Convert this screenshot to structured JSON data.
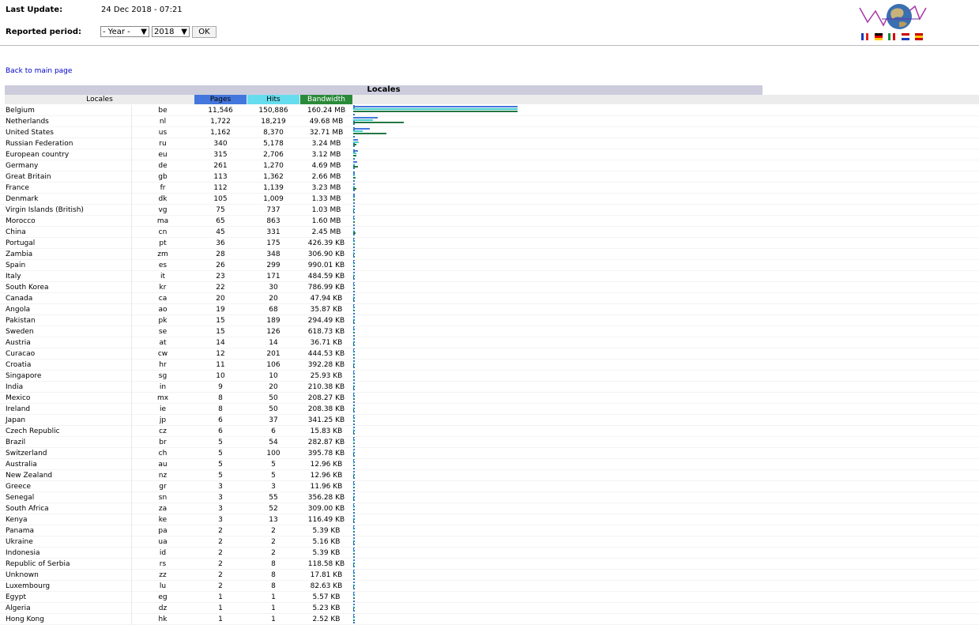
{
  "header": {
    "last_update_label": "Last Update:",
    "last_update_value": "24 Dec 2018 - 07:21",
    "reported_period_label": "Reported period:",
    "period_select": "- Year -",
    "year_select": "2018",
    "ok_label": "OK"
  },
  "flags": [
    "flag-fr",
    "flag-de",
    "flag-it",
    "flag-nl",
    "flag-es"
  ],
  "back_link": "Back to main page",
  "table": {
    "title": "Locales",
    "columns": {
      "locales": "Locales",
      "pages": "Pages",
      "hits": "Hits",
      "bandwidth": "Bandwidth"
    },
    "colors": {
      "pages": "#4477dd",
      "hits": "#66ddee",
      "bandwidth": "#2a8a3a"
    },
    "rows": [
      {
        "name": "Belgium",
        "code": "be",
        "pages": "11,546",
        "hits": "150,886",
        "bw": "160.24 MB",
        "p": 11546,
        "h": 150886,
        "b": 160.24
      },
      {
        "name": "Netherlands",
        "code": "nl",
        "pages": "1,722",
        "hits": "18,219",
        "bw": "49.68 MB",
        "p": 1722,
        "h": 18219,
        "b": 49.68
      },
      {
        "name": "United States",
        "code": "us",
        "pages": "1,162",
        "hits": "8,370",
        "bw": "32.71 MB",
        "p": 1162,
        "h": 8370,
        "b": 32.71
      },
      {
        "name": "Russian Federation",
        "code": "ru",
        "pages": "340",
        "hits": "5,178",
        "bw": "3.24 MB",
        "p": 340,
        "h": 5178,
        "b": 3.24
      },
      {
        "name": "European country",
        "code": "eu",
        "pages": "315",
        "hits": "2,706",
        "bw": "3.12 MB",
        "p": 315,
        "h": 2706,
        "b": 3.12
      },
      {
        "name": "Germany",
        "code": "de",
        "pages": "261",
        "hits": "1,270",
        "bw": "4.69 MB",
        "p": 261,
        "h": 1270,
        "b": 4.69
      },
      {
        "name": "Great Britain",
        "code": "gb",
        "pages": "113",
        "hits": "1,362",
        "bw": "2.66 MB",
        "p": 113,
        "h": 1362,
        "b": 2.66
      },
      {
        "name": "France",
        "code": "fr",
        "pages": "112",
        "hits": "1,139",
        "bw": "3.23 MB",
        "p": 112,
        "h": 1139,
        "b": 3.23
      },
      {
        "name": "Denmark",
        "code": "dk",
        "pages": "105",
        "hits": "1,009",
        "bw": "1.33 MB",
        "p": 105,
        "h": 1009,
        "b": 1.33
      },
      {
        "name": "Virgin Islands (British)",
        "code": "vg",
        "pages": "75",
        "hits": "737",
        "bw": "1.03 MB",
        "p": 75,
        "h": 737,
        "b": 1.03
      },
      {
        "name": "Morocco",
        "code": "ma",
        "pages": "65",
        "hits": "863",
        "bw": "1.60 MB",
        "p": 65,
        "h": 863,
        "b": 1.6
      },
      {
        "name": "China",
        "code": "cn",
        "pages": "45",
        "hits": "331",
        "bw": "2.45 MB",
        "p": 45,
        "h": 331,
        "b": 2.45
      },
      {
        "name": "Portugal",
        "code": "pt",
        "pages": "36",
        "hits": "175",
        "bw": "426.39 KB",
        "p": 36,
        "h": 175,
        "b": 0.416
      },
      {
        "name": "Zambia",
        "code": "zm",
        "pages": "28",
        "hits": "348",
        "bw": "306.90 KB",
        "p": 28,
        "h": 348,
        "b": 0.3
      },
      {
        "name": "Spain",
        "code": "es",
        "pages": "26",
        "hits": "299",
        "bw": "990.01 KB",
        "p": 26,
        "h": 299,
        "b": 0.967
      },
      {
        "name": "Italy",
        "code": "it",
        "pages": "23",
        "hits": "171",
        "bw": "484.59 KB",
        "p": 23,
        "h": 171,
        "b": 0.473
      },
      {
        "name": "South Korea",
        "code": "kr",
        "pages": "22",
        "hits": "30",
        "bw": "786.99 KB",
        "p": 22,
        "h": 30,
        "b": 0.769
      },
      {
        "name": "Canada",
        "code": "ca",
        "pages": "20",
        "hits": "20",
        "bw": "47.94 KB",
        "p": 20,
        "h": 20,
        "b": 0.047
      },
      {
        "name": "Angola",
        "code": "ao",
        "pages": "19",
        "hits": "68",
        "bw": "35.87 KB",
        "p": 19,
        "h": 68,
        "b": 0.035
      },
      {
        "name": "Pakistan",
        "code": "pk",
        "pages": "15",
        "hits": "189",
        "bw": "294.49 KB",
        "p": 15,
        "h": 189,
        "b": 0.288
      },
      {
        "name": "Sweden",
        "code": "se",
        "pages": "15",
        "hits": "126",
        "bw": "618.73 KB",
        "p": 15,
        "h": 126,
        "b": 0.604
      },
      {
        "name": "Austria",
        "code": "at",
        "pages": "14",
        "hits": "14",
        "bw": "36.71 KB",
        "p": 14,
        "h": 14,
        "b": 0.036
      },
      {
        "name": "Curacao",
        "code": "cw",
        "pages": "12",
        "hits": "201",
        "bw": "444.53 KB",
        "p": 12,
        "h": 201,
        "b": 0.434
      },
      {
        "name": "Croatia",
        "code": "hr",
        "pages": "11",
        "hits": "106",
        "bw": "392.28 KB",
        "p": 11,
        "h": 106,
        "b": 0.383
      },
      {
        "name": "Singapore",
        "code": "sg",
        "pages": "10",
        "hits": "10",
        "bw": "25.93 KB",
        "p": 10,
        "h": 10,
        "b": 0.025
      },
      {
        "name": "India",
        "code": "in",
        "pages": "9",
        "hits": "20",
        "bw": "210.38 KB",
        "p": 9,
        "h": 20,
        "b": 0.205
      },
      {
        "name": "Mexico",
        "code": "mx",
        "pages": "8",
        "hits": "50",
        "bw": "208.27 KB",
        "p": 8,
        "h": 50,
        "b": 0.203
      },
      {
        "name": "Ireland",
        "code": "ie",
        "pages": "8",
        "hits": "50",
        "bw": "208.38 KB",
        "p": 8,
        "h": 50,
        "b": 0.203
      },
      {
        "name": "Japan",
        "code": "jp",
        "pages": "6",
        "hits": "37",
        "bw": "341.25 KB",
        "p": 6,
        "h": 37,
        "b": 0.333
      },
      {
        "name": "Czech Republic",
        "code": "cz",
        "pages": "6",
        "hits": "6",
        "bw": "15.83 KB",
        "p": 6,
        "h": 6,
        "b": 0.015
      },
      {
        "name": "Brazil",
        "code": "br",
        "pages": "5",
        "hits": "54",
        "bw": "282.87 KB",
        "p": 5,
        "h": 54,
        "b": 0.276
      },
      {
        "name": "Switzerland",
        "code": "ch",
        "pages": "5",
        "hits": "100",
        "bw": "395.78 KB",
        "p": 5,
        "h": 100,
        "b": 0.386
      },
      {
        "name": "Australia",
        "code": "au",
        "pages": "5",
        "hits": "5",
        "bw": "12.96 KB",
        "p": 5,
        "h": 5,
        "b": 0.013
      },
      {
        "name": "New Zealand",
        "code": "nz",
        "pages": "5",
        "hits": "5",
        "bw": "12.96 KB",
        "p": 5,
        "h": 5,
        "b": 0.013
      },
      {
        "name": "Greece",
        "code": "gr",
        "pages": "3",
        "hits": "3",
        "bw": "11.96 KB",
        "p": 3,
        "h": 3,
        "b": 0.012
      },
      {
        "name": "Senegal",
        "code": "sn",
        "pages": "3",
        "hits": "55",
        "bw": "356.28 KB",
        "p": 3,
        "h": 55,
        "b": 0.348
      },
      {
        "name": "South Africa",
        "code": "za",
        "pages": "3",
        "hits": "52",
        "bw": "309.00 KB",
        "p": 3,
        "h": 52,
        "b": 0.302
      },
      {
        "name": "Kenya",
        "code": "ke",
        "pages": "3",
        "hits": "13",
        "bw": "116.49 KB",
        "p": 3,
        "h": 13,
        "b": 0.114
      },
      {
        "name": "Panama",
        "code": "pa",
        "pages": "2",
        "hits": "2",
        "bw": "5.39 KB",
        "p": 2,
        "h": 2,
        "b": 0.005
      },
      {
        "name": "Ukraine",
        "code": "ua",
        "pages": "2",
        "hits": "2",
        "bw": "5.16 KB",
        "p": 2,
        "h": 2,
        "b": 0.005
      },
      {
        "name": "Indonesia",
        "code": "id",
        "pages": "2",
        "hits": "2",
        "bw": "5.39 KB",
        "p": 2,
        "h": 2,
        "b": 0.005
      },
      {
        "name": "Republic of Serbia",
        "code": "rs",
        "pages": "2",
        "hits": "8",
        "bw": "118.58 KB",
        "p": 2,
        "h": 8,
        "b": 0.116
      },
      {
        "name": "Unknown",
        "code": "zz",
        "pages": "2",
        "hits": "8",
        "bw": "17.81 KB",
        "p": 2,
        "h": 8,
        "b": 0.017
      },
      {
        "name": "Luxembourg",
        "code": "lu",
        "pages": "2",
        "hits": "8",
        "bw": "82.63 KB",
        "p": 2,
        "h": 8,
        "b": 0.081
      },
      {
        "name": "Egypt",
        "code": "eg",
        "pages": "1",
        "hits": "1",
        "bw": "5.57 KB",
        "p": 1,
        "h": 1,
        "b": 0.005
      },
      {
        "name": "Algeria",
        "code": "dz",
        "pages": "1",
        "hits": "1",
        "bw": "5.23 KB",
        "p": 1,
        "h": 1,
        "b": 0.005
      },
      {
        "name": "Hong Kong",
        "code": "hk",
        "pages": "1",
        "hits": "1",
        "bw": "2.52 KB",
        "p": 1,
        "h": 1,
        "b": 0.002
      }
    ]
  }
}
